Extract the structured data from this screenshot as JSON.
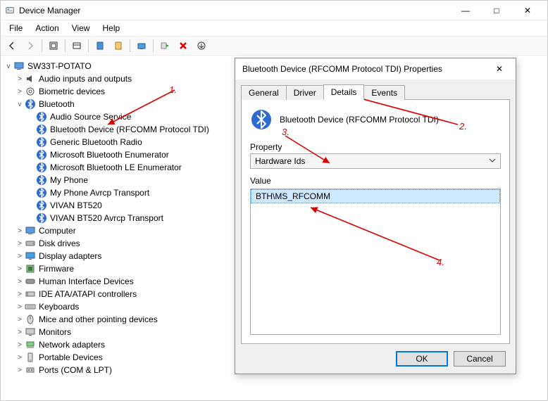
{
  "window": {
    "title": "Device Manager",
    "menu": [
      "File",
      "Action",
      "View",
      "Help"
    ],
    "winbuttons": {
      "min": "—",
      "max": "□",
      "close": "✕"
    }
  },
  "toolbar_icons": [
    "back-icon",
    "forward-icon",
    "up-icon",
    "show-hidden-icon",
    "properties-icon",
    "help-icon",
    "refresh-icon",
    "monitor-icon",
    "update-driver-icon",
    "disable-device-icon",
    "uninstall-device-icon"
  ],
  "tree": {
    "root": "SW33T-POTATO",
    "categories": [
      {
        "label": "Audio inputs and outputs",
        "icon": "audio",
        "exp": "closed"
      },
      {
        "label": "Biometric devices",
        "icon": "biometric",
        "exp": "closed"
      },
      {
        "label": "Bluetooth",
        "icon": "bluetooth",
        "exp": "open",
        "children": [
          "Audio Source Service",
          "Bluetooth Device (RFCOMM Protocol TDI)",
          "Generic Bluetooth Radio",
          "Microsoft Bluetooth Enumerator",
          "Microsoft Bluetooth LE Enumerator",
          "My Phone",
          "My Phone Avrcp Transport",
          "VIVAN BT520",
          "VIVAN BT520 Avrcp Transport"
        ]
      },
      {
        "label": "Computer",
        "icon": "computer",
        "exp": "closed"
      },
      {
        "label": "Disk drives",
        "icon": "disk",
        "exp": "closed"
      },
      {
        "label": "Display adapters",
        "icon": "display",
        "exp": "closed"
      },
      {
        "label": "Firmware",
        "icon": "firmware",
        "exp": "closed"
      },
      {
        "label": "Human Interface Devices",
        "icon": "hid",
        "exp": "closed"
      },
      {
        "label": "IDE ATA/ATAPI controllers",
        "icon": "ide",
        "exp": "closed"
      },
      {
        "label": "Keyboards",
        "icon": "keyboard",
        "exp": "closed"
      },
      {
        "label": "Mice and other pointing devices",
        "icon": "mouse",
        "exp": "closed"
      },
      {
        "label": "Monitors",
        "icon": "monitor",
        "exp": "closed"
      },
      {
        "label": "Network adapters",
        "icon": "network",
        "exp": "closed"
      },
      {
        "label": "Portable Devices",
        "icon": "portable",
        "exp": "closed"
      },
      {
        "label": "Ports (COM & LPT)",
        "icon": "ports",
        "exp": "closed"
      }
    ]
  },
  "dialog": {
    "title": "Bluetooth Device (RFCOMM Protocol TDI) Properties",
    "tabs": [
      "General",
      "Driver",
      "Details",
      "Events"
    ],
    "active_tab": "Details",
    "device_name": "Bluetooth Device (RFCOMM Protocol TDI)",
    "property_label": "Property",
    "property_value": "Hardware Ids",
    "value_label": "Value",
    "value_item": "BTH\\MS_RFCOMM",
    "ok": "OK",
    "cancel": "Cancel"
  },
  "annotations": {
    "n1": "1.",
    "n2": "2.",
    "n3": "3.",
    "n4": "4."
  }
}
